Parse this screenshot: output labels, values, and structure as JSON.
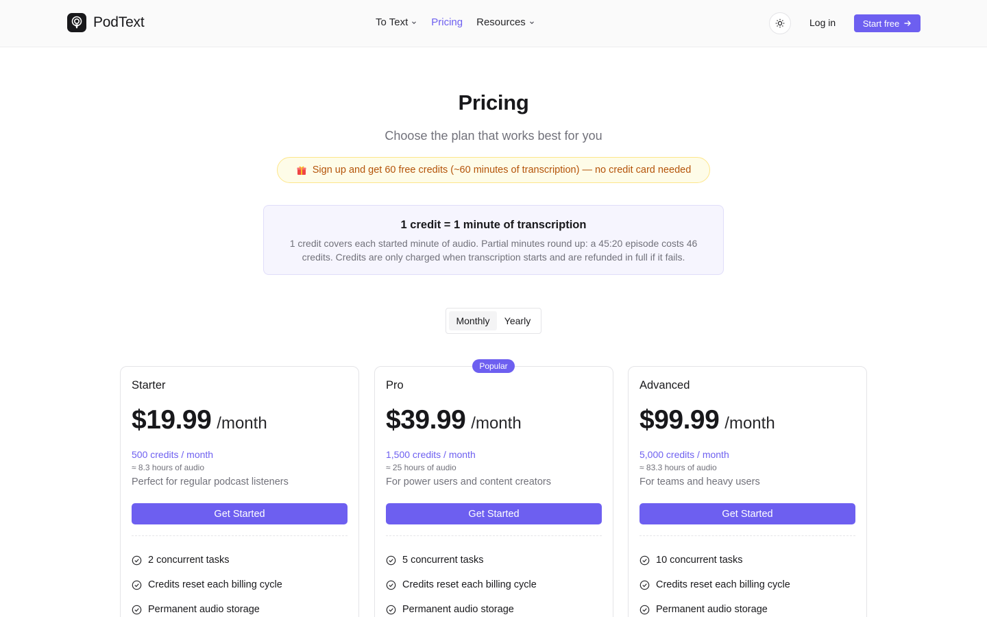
{
  "brand": {
    "name": "PodText"
  },
  "nav": {
    "items": [
      {
        "label": "To Text",
        "has_dropdown": true,
        "active": false
      },
      {
        "label": "Pricing",
        "has_dropdown": false,
        "active": true
      },
      {
        "label": "Resources",
        "has_dropdown": true,
        "active": false
      }
    ]
  },
  "header": {
    "theme_icon": "sun-icon",
    "login_label": "Log in",
    "start_label": "Start free"
  },
  "hero": {
    "title": "Pricing",
    "subtitle": "Choose the plan that works best for you",
    "promo": "Sign up and get 60 free credits (~60 minutes of transcription) — no credit card needed"
  },
  "credit_info": {
    "title": "1 credit = 1 minute of transcription",
    "description": "1 credit covers each started minute of audio. Partial minutes round up: a 45:20 episode costs 46 credits. Credits are only charged when transcription starts and are refunded in full if it fails."
  },
  "billing_toggle": {
    "options": [
      "Monthly",
      "Yearly"
    ],
    "selected": "Monthly"
  },
  "popular_badge": "Popular",
  "plans": [
    {
      "name": "Starter",
      "price": "$19.99",
      "period": "/month",
      "credits": "500 credits / month",
      "hours": "≈ 8.3 hours of audio",
      "description": "Perfect for regular podcast listeners",
      "cta": "Get Started",
      "features": [
        "2 concurrent tasks",
        "Credits reset each billing cycle",
        "Permanent audio storage"
      ]
    },
    {
      "name": "Pro",
      "price": "$39.99",
      "period": "/month",
      "credits": "1,500 credits / month",
      "hours": "≈ 25 hours of audio",
      "description": "For power users and content creators",
      "cta": "Get Started",
      "features": [
        "5 concurrent tasks",
        "Credits reset each billing cycle",
        "Permanent audio storage"
      ]
    },
    {
      "name": "Advanced",
      "price": "$99.99",
      "period": "/month",
      "credits": "5,000 credits / month",
      "hours": "≈ 83.3 hours of audio",
      "description": "For teams and heavy users",
      "cta": "Get Started",
      "features": [
        "10 concurrent tasks",
        "Credits reset each billing cycle",
        "Permanent audio storage"
      ]
    }
  ],
  "colors": {
    "accent": "#6d5ff0",
    "promo_text": "#b45309",
    "promo_bg": "#fefce8",
    "muted": "#71717a"
  }
}
